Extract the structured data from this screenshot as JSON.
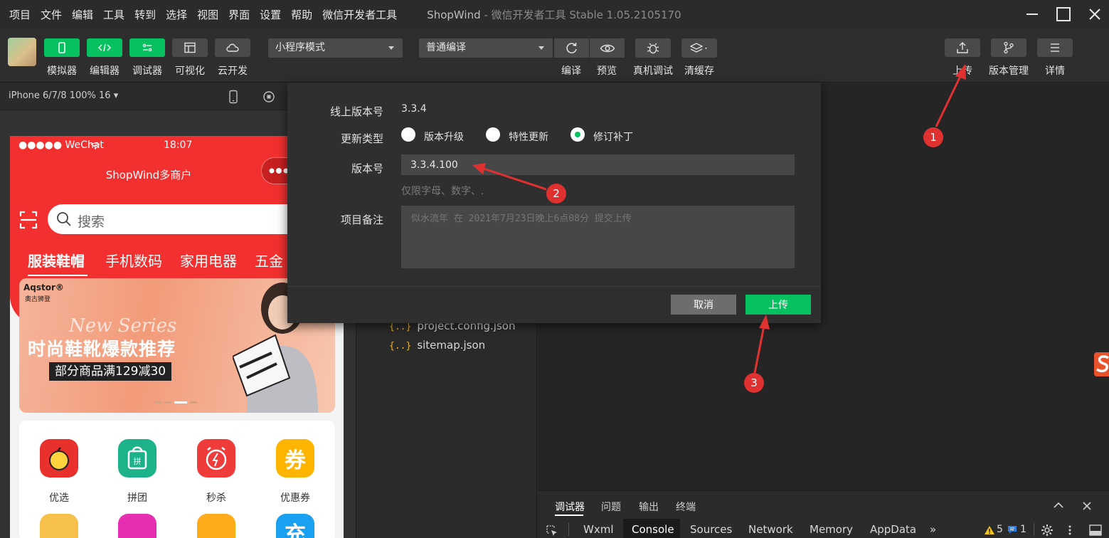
{
  "menubar": {
    "items": [
      "项目",
      "文件",
      "编辑",
      "工具",
      "转到",
      "选择",
      "视图",
      "界面",
      "设置",
      "帮助",
      "微信开发者工具"
    ],
    "window_title": "ShopWind",
    "window_subtitle": " - 微信开发者工具 Stable 1.05.2105170"
  },
  "toolbar": {
    "left_buttons": [
      {
        "label": "模拟器",
        "icon": "phone-icon",
        "active": true
      },
      {
        "label": "编辑器",
        "icon": "code-icon",
        "active": true
      },
      {
        "label": "调试器",
        "icon": "debug-toggle-icon",
        "active": true
      },
      {
        "label": "可视化",
        "icon": "layout-icon",
        "active": false
      },
      {
        "label": "云开发",
        "icon": "cloud-icon",
        "active": false
      }
    ],
    "mode_select": "小程序模式",
    "compile_select": "普通编译",
    "center_buttons": [
      {
        "label": "编译",
        "icon": "refresh-icon"
      },
      {
        "label": "预览",
        "icon": "eye-icon"
      },
      {
        "label": "真机调试",
        "icon": "bug-icon"
      },
      {
        "label": "清缓存",
        "icon": "layers-icon"
      }
    ],
    "right_buttons": [
      {
        "label": "上传",
        "icon": "upload-icon"
      },
      {
        "label": "版本管理",
        "icon": "branch-icon"
      },
      {
        "label": "详情",
        "icon": "menu-icon"
      }
    ]
  },
  "simulator": {
    "device": "iPhone 6/7/8 100% 16 ▾",
    "status": {
      "carrier": "●●●●● WeChat",
      "time": "18:07"
    },
    "nav_title": "ShopWind多商户",
    "search_placeholder": "搜索",
    "categories": [
      "服装鞋帽",
      "手机数码",
      "家用电器",
      "五金"
    ],
    "banner": {
      "brand": "Aqstor®",
      "brand_sub": "奥古狮登",
      "title": "时尚鞋靴爆款推荐",
      "subtitle": "部分商品满129减30",
      "script": "New Series"
    },
    "grid": [
      {
        "label": "优选",
        "color": "#e8302c"
      },
      {
        "label": "拼团",
        "color": "#1db38a"
      },
      {
        "label": "秒杀",
        "color": "#f03b3b"
      },
      {
        "label": "优惠券",
        "color": "#ffb400",
        "glyph": "券"
      }
    ],
    "grid_row2_glyph": "充"
  },
  "filetree": {
    "files": [
      "project.config.json",
      "sitemap.json"
    ],
    "brace": "{..}"
  },
  "debugger": {
    "tabs": [
      "调试器",
      "问题",
      "输出",
      "终端"
    ],
    "subtabs": [
      "Wxml",
      "Console",
      "Sources",
      "Network",
      "Memory",
      "AppData"
    ],
    "more": "»",
    "warn_count": "5",
    "info_count": "1"
  },
  "dialog": {
    "online_version_label": "线上版本号",
    "online_version": "3.3.4",
    "update_type_label": "更新类型",
    "update_types": [
      {
        "label": "版本升级",
        "checked": false
      },
      {
        "label": "特性更新",
        "checked": false
      },
      {
        "label": "修订补丁",
        "checked": true
      }
    ],
    "version_label": "版本号",
    "version_value": "3.3.4.100",
    "version_hint": "仅限字母、数字、.",
    "remark_label": "项目备注",
    "remark_placeholder": "似水流年 在 2021年7月23日晚上6点08分 提交上传",
    "cancel_label": "取消",
    "upload_label": "上传"
  },
  "annotations": [
    "1",
    "2",
    "3"
  ],
  "colors": {
    "accent": "#07c160",
    "marker": "#e03131",
    "phone_header": "#f23030"
  }
}
